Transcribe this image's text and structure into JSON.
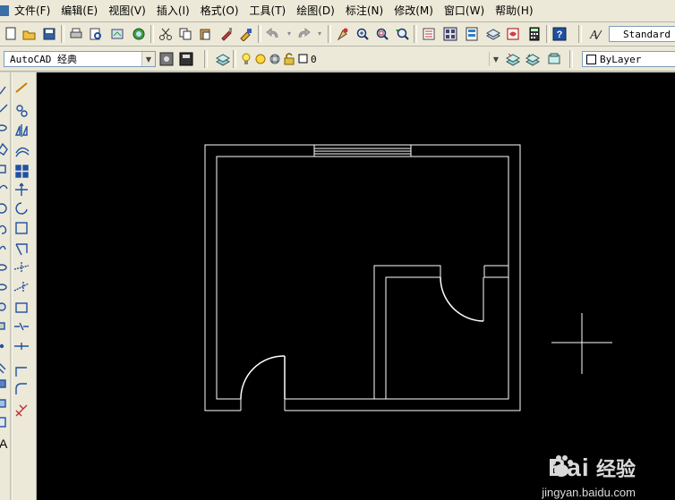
{
  "menu": {
    "items": [
      {
        "label": "文件(F)"
      },
      {
        "label": "编辑(E)"
      },
      {
        "label": "视图(V)"
      },
      {
        "label": "插入(I)"
      },
      {
        "label": "格式(O)"
      },
      {
        "label": "工具(T)"
      },
      {
        "label": "绘图(D)"
      },
      {
        "label": "标注(N)"
      },
      {
        "label": "修改(M)"
      },
      {
        "label": "窗口(W)"
      },
      {
        "label": "帮助(H)"
      }
    ]
  },
  "toolbar": {
    "text_style_value": "Standard",
    "workspace_value": "AutoCAD 经典",
    "layer_value": "0",
    "color_value": "ByLayer"
  },
  "icons": {
    "standard": [
      "new-icon",
      "open-icon",
      "save-icon",
      "print-icon",
      "print-preview-icon",
      "publish-icon",
      "3d-dwf-icon",
      "cut-icon",
      "copy-icon",
      "paste-icon",
      "match-properties-icon",
      "block-editor-icon",
      "undo-icon",
      "redo-icon",
      "pan-icon",
      "zoom-realtime-icon",
      "zoom-window-icon",
      "zoom-previous-icon",
      "properties-icon",
      "design-center-icon",
      "tool-palettes-icon",
      "sheet-set-icon",
      "markup-icon",
      "quickcalc-icon",
      "help-icon",
      "text-style-icon"
    ],
    "draw": [
      "line-icon",
      "construction-line-icon",
      "polyline-icon",
      "polygon-icon",
      "rectangle-icon",
      "arc-icon",
      "circle-icon",
      "revision-cloud-icon",
      "spline-icon",
      "ellipse-icon",
      "ellipse-arc-icon",
      "insert-block-icon",
      "make-block-icon",
      "point-icon",
      "hatch-icon",
      "gradient-icon",
      "region-icon",
      "table-icon",
      "multiline-text-icon"
    ],
    "modify": [
      "erase-icon",
      "copy-object-icon",
      "mirror-icon",
      "offset-icon",
      "array-icon",
      "move-icon",
      "rotate-icon",
      "scale-icon",
      "stretch-icon",
      "trim-icon",
      "extend-icon",
      "break-at-point-icon",
      "break-icon",
      "join-icon",
      "chamfer-icon",
      "fillet-icon",
      "explode-icon"
    ]
  },
  "colors": {
    "canvas": "#000000",
    "drawing_lines": "#ffffff",
    "ui_face": "#ece9d8"
  },
  "watermark": {
    "brand": "Bai",
    "brand_cn": "经验",
    "url": "jingyan.baidu.com"
  }
}
